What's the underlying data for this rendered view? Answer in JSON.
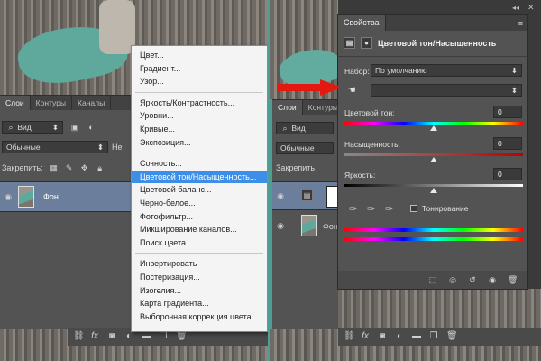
{
  "colors": {
    "accent": "#3d8ee6",
    "arrow": "#e3190f",
    "teal": "#4e9e95"
  },
  "left_layers": {
    "tabs": [
      "Слои",
      "Контуры",
      "Каналы"
    ],
    "kind_label": "Вид",
    "blend_mode": "Обычные",
    "opacity_label": "Не",
    "lock_label": "Закрепить:",
    "layer_name": "Фон"
  },
  "menu": {
    "groups": [
      [
        "Цвет...",
        "Градиент...",
        "Узор..."
      ],
      [
        "Яркость/Контрастность...",
        "Уровни...",
        "Кривые...",
        "Экспозиция..."
      ],
      [
        "Сочность...",
        "Цветовой тон/Насыщенность...",
        "Цветовой баланс...",
        "Черно-белое...",
        "Фотофильтр...",
        "Микширование каналов...",
        "Поиск цвета..."
      ],
      [
        "Инвертировать",
        "Постеризация...",
        "Изогелия...",
        "Карта градиента...",
        "Выборочная коррекция цвета..."
      ]
    ],
    "selected": "Цветовой тон/Насыщенность..."
  },
  "right_layers": {
    "tabs": [
      "Слои",
      "Контуры"
    ],
    "kind_label": "Вид",
    "blend_mode": "Обычные",
    "lock_label": "Закрепить:",
    "layer_name": "Фон"
  },
  "properties": {
    "tab": "Свойства",
    "title": "Цветовой тон/Насыщенность",
    "preset_label": "Набор:",
    "preset_value": "По умолчанию",
    "channel_value": "",
    "hue_label": "Цветовой тон:",
    "hue_value": "0",
    "saturation_label": "Насыщенность:",
    "saturation_value": "0",
    "lightness_label": "Яркость:",
    "lightness_value": "0",
    "colorize_label": "Тонирование"
  },
  "icons": [
    "eye-icon",
    "link-icon",
    "fx-icon",
    "mask-icon",
    "adjustment-icon",
    "folder-icon",
    "new-layer-icon",
    "trash-icon",
    "dropper-icon",
    "hand-icon"
  ]
}
